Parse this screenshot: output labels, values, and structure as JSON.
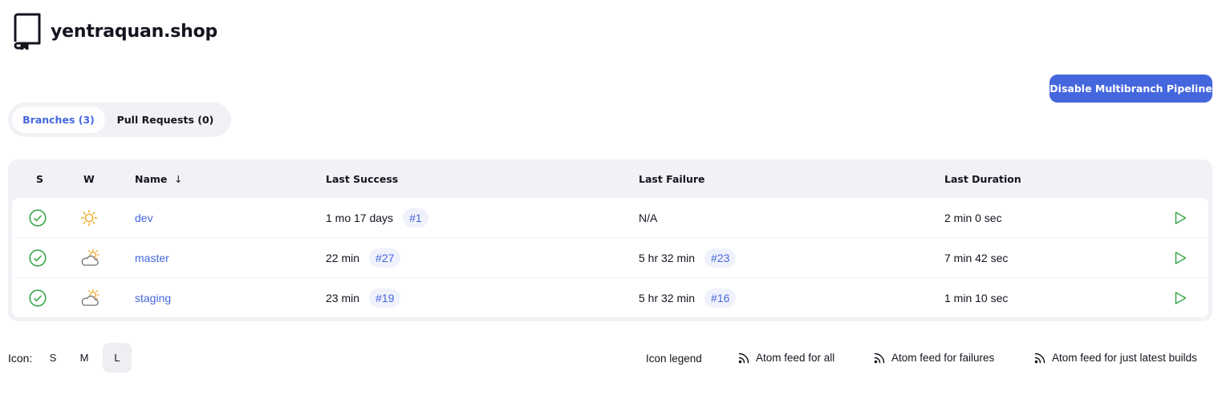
{
  "header": {
    "title": "yentraquan.shop"
  },
  "toolbar": {
    "disable_label": "Disable Multibranch Pipeline"
  },
  "tabs": [
    {
      "label": "Branches (3)",
      "active": true
    },
    {
      "label": "Pull Requests (0)",
      "active": false
    }
  ],
  "table": {
    "columns": {
      "s": "S",
      "w": "W",
      "name": "Name",
      "sort_arrow": "↓",
      "last_success": "Last Success",
      "last_failure": "Last Failure",
      "last_duration": "Last Duration"
    },
    "rows": [
      {
        "status": "success",
        "weather": "sunny",
        "name": "dev",
        "last_success": "1 mo 17 days",
        "last_success_build": "#1",
        "last_failure": "N/A",
        "last_failure_build": "",
        "duration": "2 min 0 sec"
      },
      {
        "status": "success",
        "weather": "cloudy",
        "name": "master",
        "last_success": "22 min",
        "last_success_build": "#27",
        "last_failure": "5 hr 32 min",
        "last_failure_build": "#23",
        "duration": "7 min 42 sec"
      },
      {
        "status": "success",
        "weather": "cloudy",
        "name": "staging",
        "last_success": "23 min",
        "last_success_build": "#19",
        "last_failure": "5 hr 32 min",
        "last_failure_build": "#16",
        "duration": "1 min 10 sec"
      }
    ]
  },
  "footer": {
    "icon_label": "Icon:",
    "sizes": [
      {
        "label": "S",
        "active": false
      },
      {
        "label": "M",
        "active": false
      },
      {
        "label": "L",
        "active": true
      }
    ],
    "legend": "Icon legend",
    "feed_all": "Atom feed for all",
    "feed_failures": "Atom feed for failures",
    "feed_latest": "Atom feed for just latest builds"
  },
  "colors": {
    "accent": "#4567de",
    "success": "#3aa74b",
    "sun": "#f0a724",
    "cloud": "#6f6f78",
    "surface": "#f2f1f6"
  }
}
